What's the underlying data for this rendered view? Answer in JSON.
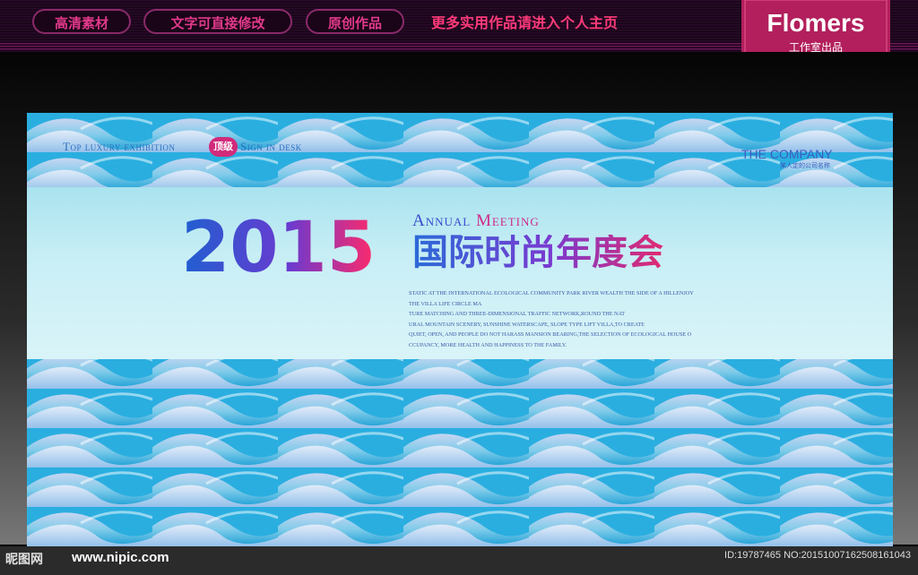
{
  "header": {
    "pills": [
      "高清素材",
      "文字可直接修改",
      "原创作品"
    ],
    "promo": "更多实用作品请进入个人主页",
    "brand_name": "Flomers",
    "brand_sub": "工作室出品"
  },
  "board": {
    "tag_left": "Top luxury exhibition",
    "badge": "顶级",
    "tag_right": "Sign in desk",
    "company": "THE COMPANY",
    "company_sub": "某人定的公司名称",
    "year": "2015",
    "annual": "Annual",
    "meeting": "Meeting",
    "title_cn": "国际时尚年度会",
    "body_lines": [
      "STATIC AT THE INTERNATIONAL ECOLOGICAL COMMUNITY PARK RIVER WEALTH THE SIDE OF A HILLENJOY",
      "THE VILLA LIFE CIRCLE MA",
      "TURE MATCHING AND THREE-DIMENSIONAL TRAFFIC NETWORK,ROUND THE NAT",
      "URAL MOUNTAIN SCENERY, SUNSHINE WATERSCAPE, SLOPE TYPE LIFT VILLA,TO CREATE",
      "QUIET, OPEN, AND PEOPLE DO NOT HARASS MANSION BEARING,THE SELECTION OF ECOLOGICAL HOUSE O",
      "CCUPANCY, MORE HEALTH AND HAPPINESS TO THE FAMILY."
    ]
  },
  "watermark": {
    "logo": "昵图网",
    "site": "www.nipic.com",
    "id_text": "ID:19787465 NO:20151007162508161043"
  },
  "colors": {
    "accent_pink": "#e03a8a",
    "wave_blue": "#1aa3d6",
    "wave_light": "#cfd8f0"
  }
}
